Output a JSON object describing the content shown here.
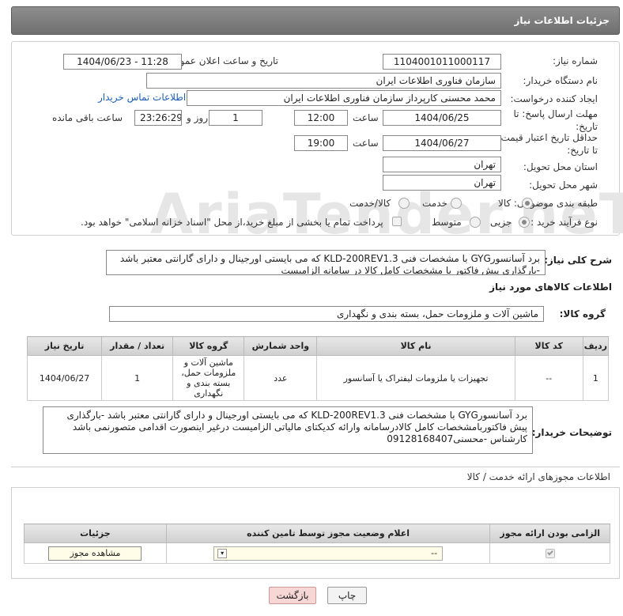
{
  "header": {
    "title": "جزئیات اطلاعات نیاز"
  },
  "form": {
    "need_number_label": "شماره نیاز:",
    "need_number": "1104001011000117",
    "announce_label": "تاریخ و ساعت اعلان عمومی:",
    "announce_value": "1404/06/23 - 11:28",
    "buyer_org_label": "نام دستگاه خریدار:",
    "buyer_org": "سازمان فناوری اطلاعات ایران",
    "creator_label": "ایجاد کننده درخواست:",
    "creator": "محمد محسنی کارپرداز سازمان فناوری اطلاعات ایران",
    "contact_link": "اطلاعات تماس خریدار",
    "deadline_label": "مهلت ارسال پاسخ: تا تاریخ:",
    "deadline_date": "1404/06/25",
    "time_label": "ساعت",
    "deadline_time": "12:00",
    "days_value": "1",
    "days_label": "روز و",
    "remaining_value": "23:26:29",
    "remaining_label": "ساعت باقی مانده",
    "price_validity_label": "حداقل تاریخ اعتبار قیمت: تا تاریخ:",
    "price_validity_date": "1404/06/27",
    "price_validity_time": "19:00",
    "province_label": "استان محل تحویل:",
    "province": "تهران",
    "city_label": "شهر محل تحویل:",
    "city": "تهران",
    "category_label": "طبقه بندی موضوعی:",
    "category_options": [
      "کالا",
      "خدمت",
      "کالا/خدمت"
    ],
    "process_label": "نوع فرآیند خرید :",
    "process_options": [
      "جزیی",
      "متوسط"
    ],
    "payment_note": "پرداخت تمام یا بخشی از مبلغ خرید،از محل \"اسناد خزانه اسلامی\" خواهد بود."
  },
  "description": {
    "label": "شرح کلی نیاز:",
    "text": "برد آسانسورGYG با مشخصات فنی KLD-200REV1.3 که می بایستی اورجینال و دارای گارانتی معتبر باشد -بارگذاری پیش فاکتور با مشخصات کامل کالا در سامانه الزامیست"
  },
  "goods": {
    "section_title": "اطلاعات کالاهای مورد نیاز",
    "group_label": "گروه کالا:",
    "group_value": "ماشین آلات و ملزومات حمل، بسته بندی و نگهداری",
    "columns": [
      "ردیف",
      "کد کالا",
      "نام کالا",
      "واحد شمارش",
      "گروه کالا",
      "تعداد / مقدار",
      "تاریخ نیاز"
    ],
    "rows": [
      {
        "row": "1",
        "code": "--",
        "name": "تجهیزات یا ملزومات لیفتراک یا آسانسور",
        "unit": "عدد",
        "group": "ماشین آلات و ملزومات حمل، بسته بندی و نگهداری",
        "qty": "1",
        "date": "1404/06/27"
      }
    ]
  },
  "buyer_notes": {
    "label": "توضیحات خریدار:",
    "text": "برد آسانسورGYG با مشخصات فنی KLD-200REV1.3 که می بایستی اورجینال و دارای گارانتی معتبر باشد -بارگذاری پیش فاکتوربامشخصات کامل کالادرسامانه وارائه کدیکتای مالیاتی الزامیست درغیر اینصورت اقدامی متصورنمی باشد کارشناس -محسنی09128168407"
  },
  "licenses": {
    "section_title": "اطلاعات مجوزهای ارائه خدمت / کالا",
    "columns": [
      "الزامی بودن ارائه مجوز",
      "اعلام وضعیت مجوز توسط تامین کننده",
      "جزئیات"
    ],
    "select_value": "--",
    "view_button": "مشاهده مجوز"
  },
  "actions": {
    "print": "چاپ",
    "back": "بازگشت"
  },
  "watermark": "AriaTender.neT",
  "colors": {
    "header": "#7a7a7a",
    "link": "#1a5fb4",
    "back_button": "#f7d6d6",
    "print_button": "#f3f3f3"
  }
}
